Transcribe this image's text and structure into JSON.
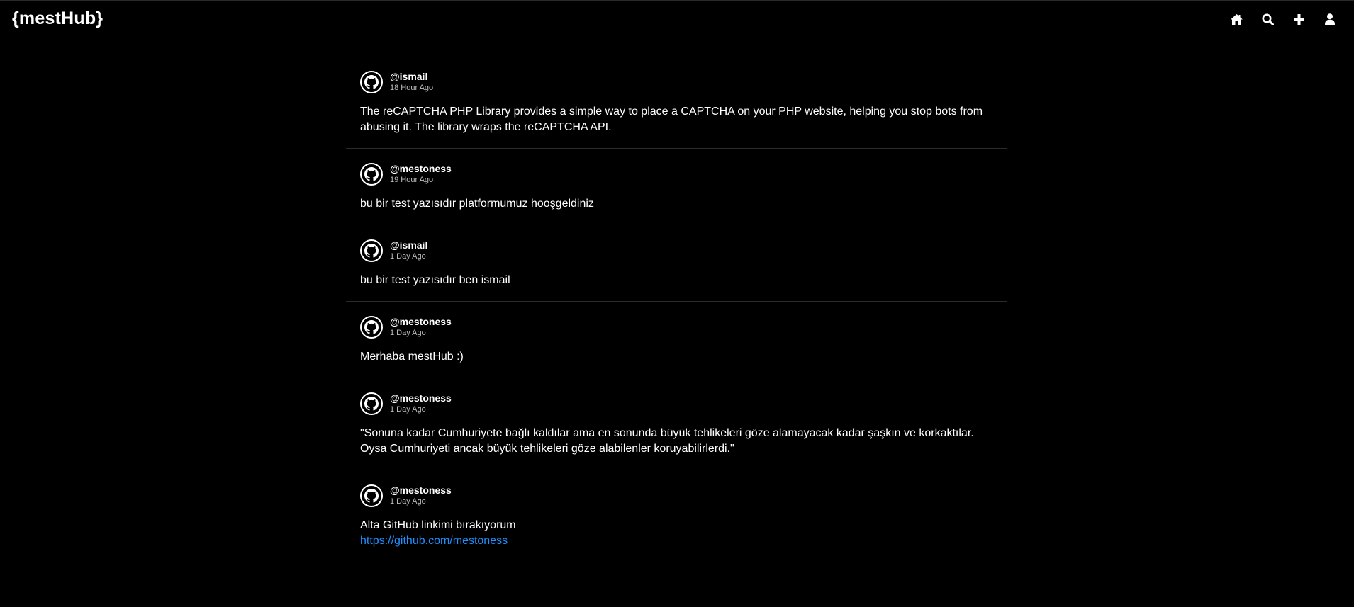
{
  "header": {
    "brand": "{mestHub}",
    "nav": [
      {
        "icon": "home-icon"
      },
      {
        "icon": "search-icon"
      },
      {
        "icon": "plus-icon"
      },
      {
        "icon": "user-icon"
      }
    ]
  },
  "posts": [
    {
      "username": "@ismail",
      "time": "18 Hour Ago",
      "body": "The reCAPTCHA PHP Library provides a simple way to place a CAPTCHA on your PHP website, helping you stop bots from\nabusing it. The library wraps the reCAPTCHA API."
    },
    {
      "username": "@mestoness",
      "time": "19 Hour Ago",
      "body": "bu bir test yazısıdır platformumuz hooşgeldiniz"
    },
    {
      "username": "@ismail",
      "time": "1 Day Ago",
      "body": "bu bir test yazısıdır ben ismail"
    },
    {
      "username": "@mestoness",
      "time": "1 Day Ago",
      "body": "Merhaba mestHub :)"
    },
    {
      "username": "@mestoness",
      "time": "1 Day Ago",
      "body": "\"Sonuna kadar Cumhuriyete bağlı kaldılar ama en sonunda büyük tehlikeleri göze alamayacak kadar şaşkın ve korkaktılar.\nOysa Cumhuriyeti ancak büyük tehlikeleri göze alabilenler koruyabilirlerdi.\""
    },
    {
      "username": "@mestoness",
      "time": "1 Day Ago",
      "body": "Alta GitHub linkimi bırakıyorum",
      "link": "https://github.com/mestoness"
    }
  ],
  "colors": {
    "background": "#000000",
    "text": "#ffffff",
    "link": "#1e90ff",
    "divider": "#2b2b2b"
  }
}
